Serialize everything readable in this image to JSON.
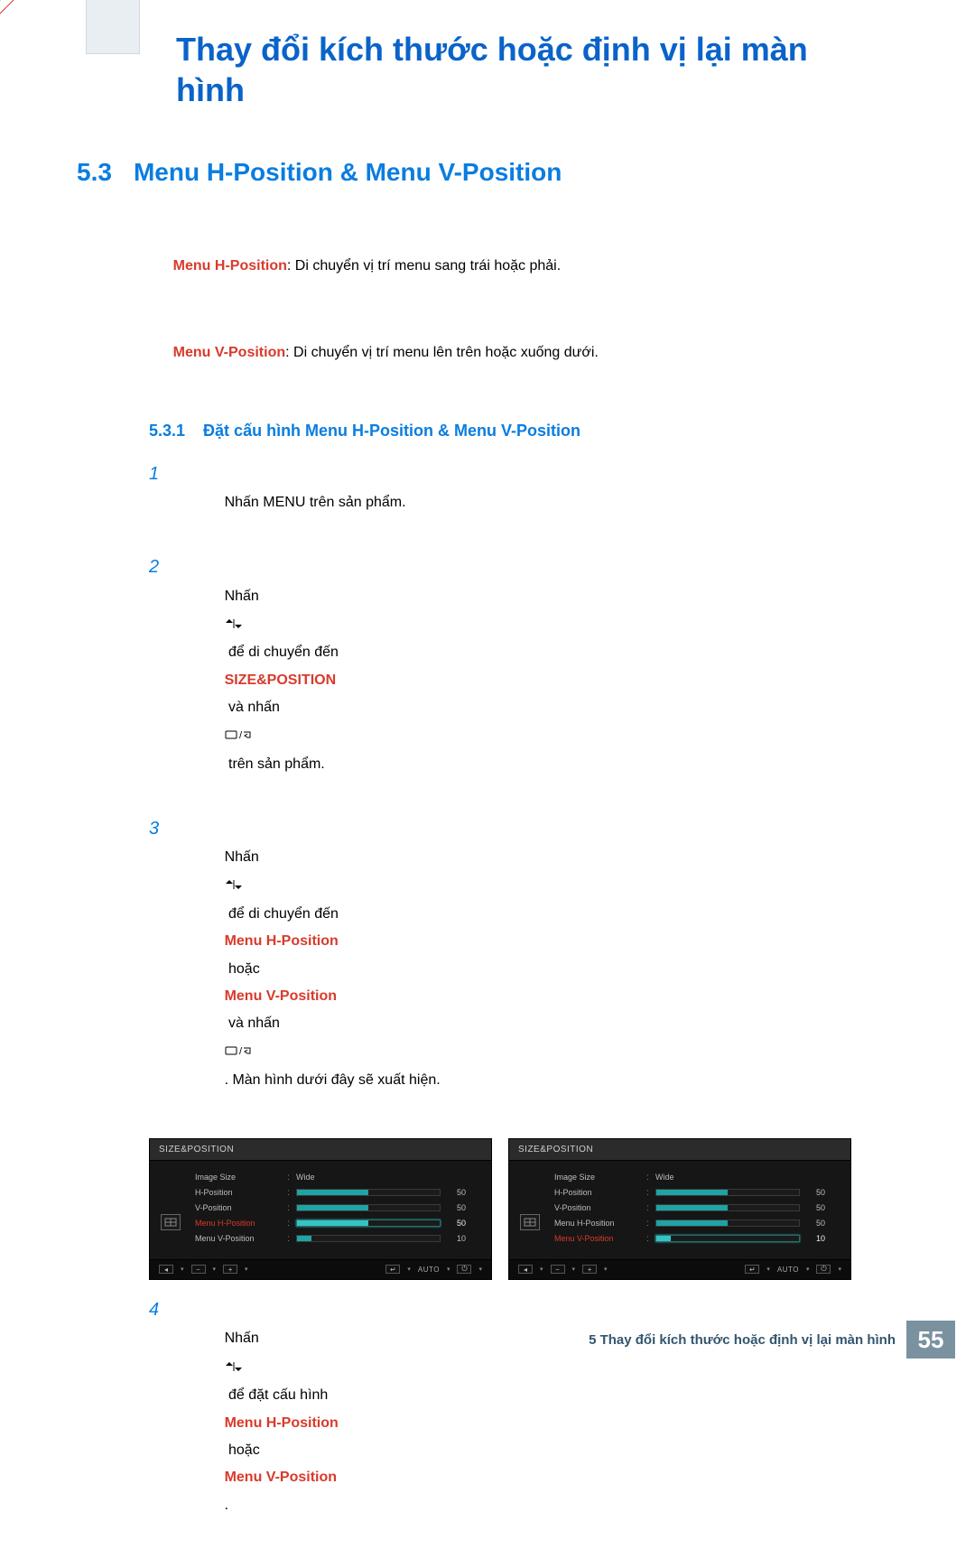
{
  "page_title": "Thay đổi kích thước hoặc định vị lại màn hình",
  "section": {
    "number": "5.3",
    "title": "Menu H-Position & Menu V-Position"
  },
  "desc": {
    "line1_label": "Menu H-Position",
    "line1_rest": ": Di chuyển vị trí menu sang trái hoặc phải.",
    "line2_label": "Menu V-Position",
    "line2_rest": ": Di chuyển vị trí menu lên trên hoặc xuống dưới."
  },
  "subsection": {
    "number": "5.3.1",
    "title": "Đặt cấu hình Menu H-Position & Menu V-Position"
  },
  "steps": {
    "s1": {
      "num": "1",
      "text_pre": "Nhấn ",
      "menu": "MENU",
      "text_post": " trên sản phẩm."
    },
    "s2": {
      "num": "2",
      "pre": "Nhấn ",
      "mid": " để di chuyển đến ",
      "kw": "SIZE&POSITION",
      "post1": " và nhấn ",
      "post2": " trên sản phẩm."
    },
    "s3": {
      "num": "3",
      "pre": "Nhấn ",
      "mid": " để di chuyển đến ",
      "kw1": "Menu H-Position",
      "or": " hoặc ",
      "kw2": "Menu V-Position",
      "post1": " và nhấn ",
      "tail": ". Màn hình dưới đây sẽ xuất hiện."
    },
    "s4": {
      "num": "4",
      "pre": "Nhấn ",
      "mid": " để đặt cấu hình ",
      "kw1": "Menu H-Position",
      "or": " hoặc ",
      "kw2": "Menu V-Position",
      "post": "."
    }
  },
  "osd": {
    "title": "SIZE&POSITION",
    "items": {
      "imagesize": {
        "label": "Image Size",
        "value": "Wide"
      },
      "hpos": {
        "label": "H-Position",
        "value": "50"
      },
      "vpos": {
        "label": "V-Position",
        "value": "50"
      },
      "menuh": {
        "label": "Menu H-Position",
        "value": "50"
      },
      "menuv": {
        "label": "Menu V-Position",
        "value": "10"
      }
    },
    "bottom": {
      "auto": "AUTO"
    }
  },
  "osd_left_highlight": "menuh",
  "osd_right_highlight": "menuv",
  "footer": {
    "text": "5 Thay đổi kích thước hoặc định vị lại màn hình",
    "page": "55"
  }
}
